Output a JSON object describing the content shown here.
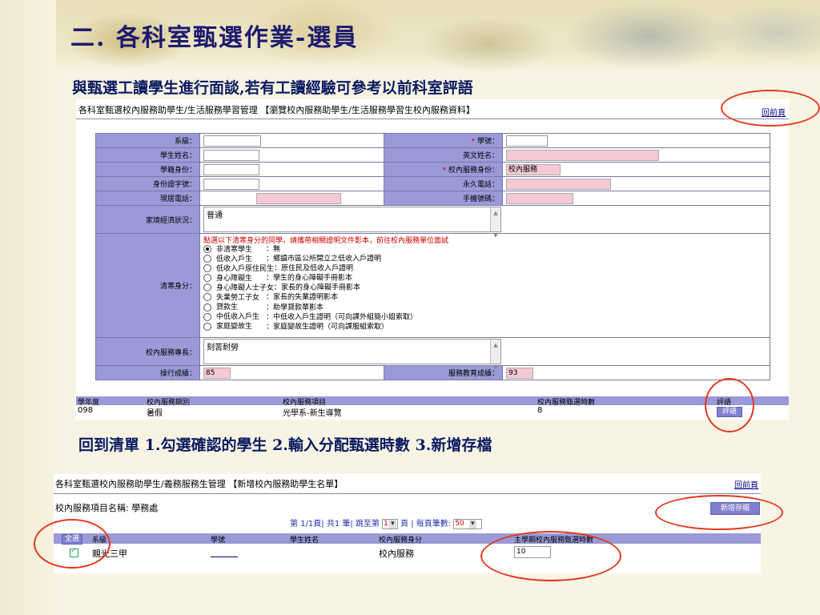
{
  "slide": {
    "title": "二. 各科室甄選作業-選員",
    "subtitle1": "與甄選工讀學生進行面談,若有工讀經驗可參考以前科室評語",
    "subtitle2": "回到清單 1.勾選確認的學生 2.輸入分配甄選時數 3.新增存檔"
  },
  "shot1": {
    "header": "各科室甄選校內服務助學生/生活服務學習管理 【瀏覽校內服務助學生/生活服務學習生校內服務資料】",
    "back_link": "回前頁",
    "labels": {
      "dept": "系級：",
      "student_id": "學號：",
      "name": "學生姓名：",
      "english_name": "英文姓名：",
      "status": "學籍身份：",
      "service_identity": "校內服務身份：",
      "id_number": "身份證字號：",
      "perm_phone": "永久電話：",
      "phone": "現居電話：",
      "mobile": "手機號碼：",
      "family_econ": "家境經濟狀況：",
      "poor_status": "清寒身分：",
      "specialty": "校內服務專長：",
      "conduct": "操行成績：",
      "service_edu": "服務教育成績："
    },
    "required_mark": "*",
    "values": {
      "service_identity": "校內服務",
      "family_econ": "普通",
      "specialty": "刻苦耐勞",
      "conduct": "85",
      "service_edu": "93"
    },
    "poor_hint": "點選以下清寒身分的同學，請攜帶相關證明文件影本，前往校內服務單位面試",
    "poor_options": [
      {
        "k": "非清寒學生",
        "v": "：無",
        "on": true
      },
      {
        "k": "低收入戶生",
        "v": "：鄉鎮市區公所開立之低收入戶證明",
        "on": false
      },
      {
        "k": "低收入戶原住民生",
        "v": "：原住民及低收入戶證明",
        "on": false
      },
      {
        "k": "身心障礙生",
        "v": "：學生的身心障礙手冊影本",
        "on": false
      },
      {
        "k": "身心障礙人士子女",
        "v": "：家長的身心障礙手冊影本",
        "on": false
      },
      {
        "k": "失業勞工子女",
        "v": "：家長的失業證明影本",
        "on": false
      },
      {
        "k": "貸款生",
        "v": "：助學貸款單影本",
        "on": false
      },
      {
        "k": "中低收入戶生",
        "v": "：中低收入戶生證明（可向課外組簡小姐索取）",
        "on": false
      },
      {
        "k": "家庭變故生",
        "v": "：家庭變故生證明（可向課服組索取）",
        "on": false
      }
    ],
    "history": {
      "headers": [
        "學年度",
        "校內服務期別",
        "校內服務項目",
        "校內服務甄選時數",
        "評語"
      ],
      "row": [
        "098",
        "暑假",
        "光學系-新生導覽",
        "8"
      ],
      "button": "評語"
    }
  },
  "shot2": {
    "header": "各科室甄選校內服務助學生/義務服務生管理 【新增校內服務助學生名單】",
    "back_link": "回前頁",
    "project": "校內服務項目名稱: 學務處",
    "add_button": "新增存檔",
    "pager": {
      "page_info": "第 1/1頁| 共1 筆| 跳至第",
      "page_value": "1",
      "page_suffix": "頁 | 每頁筆數:",
      "size_value": "50"
    },
    "columns": [
      "全選",
      "系級",
      "學號",
      "學生姓名",
      "校內服務身分",
      "主學期校內服務甄選時數"
    ],
    "row": {
      "dept": "親光三甲",
      "identity": "校內服務",
      "hours": "10"
    }
  }
}
